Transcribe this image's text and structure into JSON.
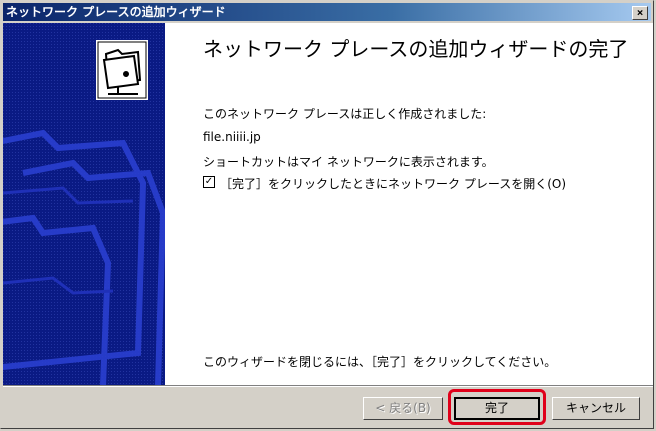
{
  "window": {
    "title": "ネットワーク プレースの追加ウィザード",
    "close_label": "×"
  },
  "content": {
    "heading": "ネットワーク プレースの追加ウィザードの完了",
    "created_text": "このネットワーク プレースは正しく作成されました:",
    "place_name": "file.niiii.jp",
    "shortcut_text": "ショートカットはマイ ネットワークに表示されます。",
    "checkbox_label": "［完了］をクリックしたときにネットワーク プレースを開く(O)",
    "checkbox_mark": "✓",
    "close_hint": "このウィザードを閉じるには、［完了］をクリックしてください。"
  },
  "buttons": {
    "back_label": "< 戻る(B)",
    "finish_label": "完了",
    "cancel_label": "キャンセル"
  },
  "colors": {
    "sidebar": "#0a1a84",
    "highlight": "#e0001a",
    "titlebar": "#0a246a"
  },
  "icons": [
    "network-folder-icon",
    "close-icon",
    "checkbox-check-icon"
  ]
}
